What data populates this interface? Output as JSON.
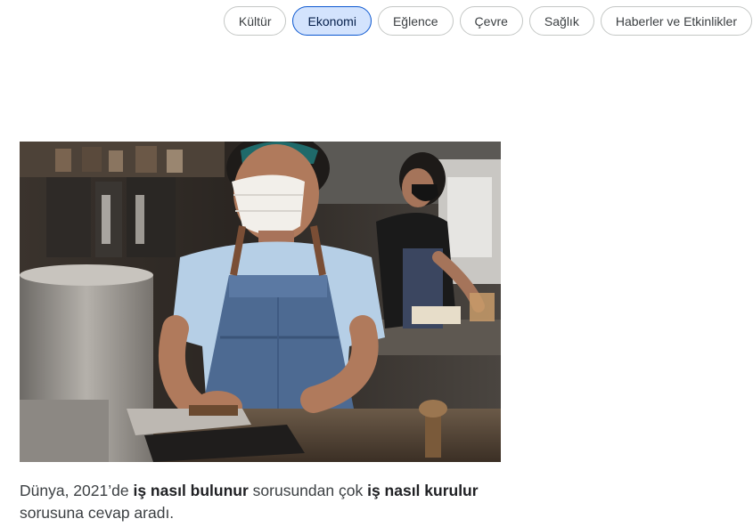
{
  "categories": {
    "items": [
      {
        "label": "Kültür",
        "active": false
      },
      {
        "label": "Ekonomi",
        "active": true
      },
      {
        "label": "Eğlence",
        "active": false
      },
      {
        "label": "Çevre",
        "active": false
      },
      {
        "label": "Sağlık",
        "active": false
      },
      {
        "label": "Haberler ve Etkinlikler",
        "active": false
      }
    ]
  },
  "story": {
    "image_icon": "cafe-workers-photo",
    "caption": {
      "part1": "Dünya, 2021’de ",
      "bold1": "iş nasıl bulunur",
      "part2": " sorusundan çok ",
      "bold2": "iş nasıl kurulur",
      "part3": " sorusuna cevap aradı."
    }
  },
  "colors": {
    "active_chip_bg": "#d3e3fd",
    "active_chip_border": "#0b57d0",
    "chip_border": "#c4c7c5",
    "text": "#3c4043"
  }
}
